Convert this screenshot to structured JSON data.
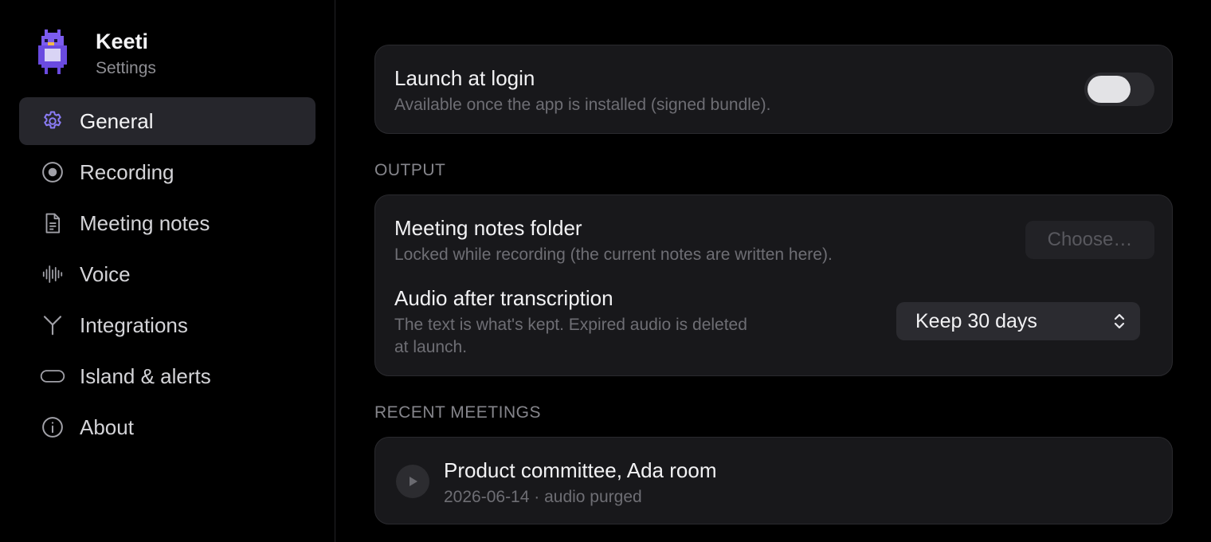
{
  "app": {
    "name": "Keeti",
    "subtitle": "Settings"
  },
  "sidebar": {
    "items": [
      {
        "label": "General",
        "icon": "gear-icon",
        "active": true
      },
      {
        "label": "Recording",
        "icon": "record-icon"
      },
      {
        "label": "Meeting notes",
        "icon": "document-icon"
      },
      {
        "label": "Voice",
        "icon": "waveform-icon"
      },
      {
        "label": "Integrations",
        "icon": "fork-icon"
      },
      {
        "label": "Island & alerts",
        "icon": "pill-icon"
      },
      {
        "label": "About",
        "icon": "info-icon"
      }
    ]
  },
  "general": {
    "launch": {
      "title": "Launch at login",
      "description": "Available once the app is installed (signed bundle).",
      "enabled": false
    },
    "output": {
      "section_label": "OUTPUT",
      "folder_title": "Meeting notes folder",
      "folder_description": "Locked while recording (the current notes are written here).",
      "choose_label": "Choose…",
      "audio_title": "Audio after transcription",
      "audio_description_1": "The text is what's kept. Expired audio is deleted",
      "audio_description_2": "at launch.",
      "audio_selected": "Keep 30 days"
    },
    "recent": {
      "section_label": "RECENT MEETINGS",
      "meetings": [
        {
          "title": "Product committee, Ada room",
          "meta": "2026-06-14 · audio purged"
        }
      ]
    }
  },
  "colors": {
    "accent": "#8b7cf6",
    "background": "#000000",
    "card": "#18181b"
  }
}
